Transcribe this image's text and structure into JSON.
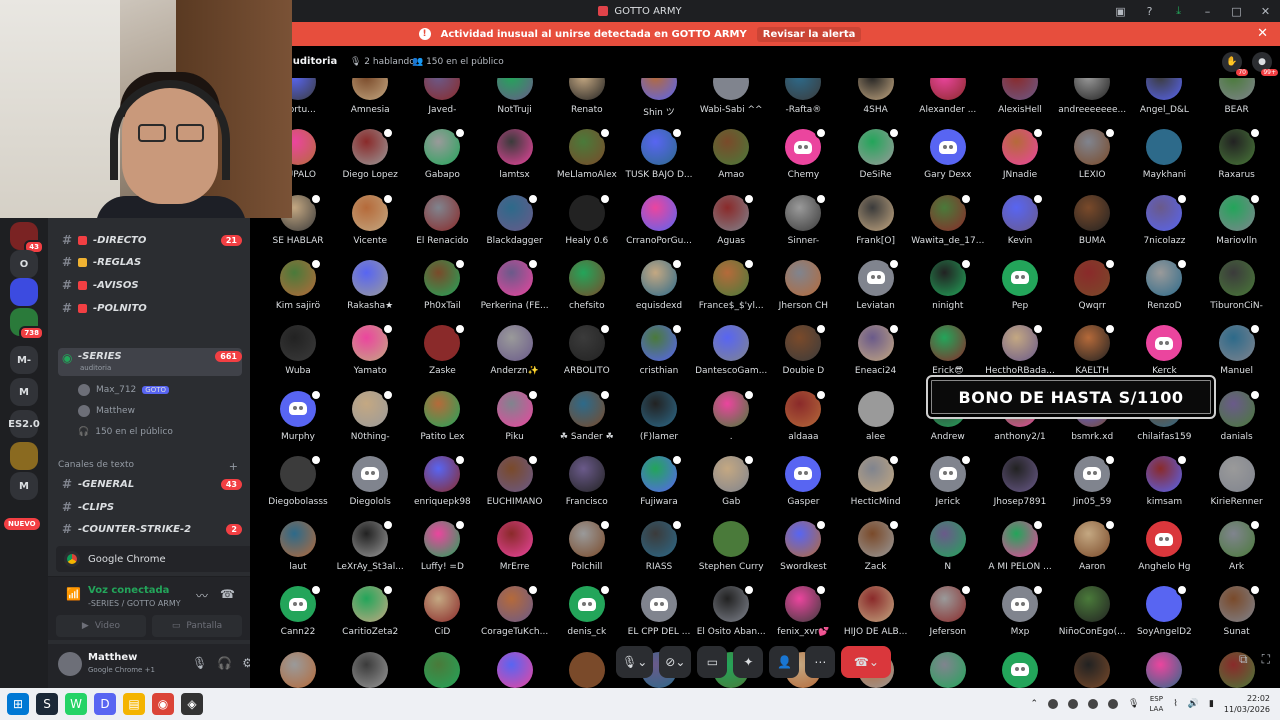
{
  "window": {
    "title": "GOTTO ARMY"
  },
  "alert": {
    "text": "Actividad inusual al unirse detectada en GOTTO ARMY",
    "link": "Revisar la alerta"
  },
  "rail": {
    "items": [
      {
        "label": "",
        "badge": "43"
      },
      {
        "label": "O",
        "badge": ""
      },
      {
        "label": "",
        "badge": ""
      },
      {
        "label": "",
        "badge": "738"
      },
      {
        "label": "M-",
        "badge": ""
      },
      {
        "label": "M",
        "badge": ""
      },
      {
        "label": "ES2.0",
        "badge": ""
      },
      {
        "label": "",
        "badge": ""
      },
      {
        "label": "M",
        "badge": ""
      }
    ],
    "new_label": "NUEVO"
  },
  "sidebar": {
    "channels_top": [
      {
        "name": "-DIRECTO",
        "count": "21",
        "color": "#f23f43"
      },
      {
        "name": "-REGLAS",
        "count": "",
        "color": "#f0b232"
      },
      {
        "name": "-AVISOS",
        "count": "",
        "color": "#f23f43"
      },
      {
        "name": "-POLNITO",
        "count": "",
        "color": "#f23f43"
      }
    ],
    "stage_channel": {
      "name": "-SERIES",
      "sub": "auditoria",
      "count": "661"
    },
    "stage_users": [
      {
        "name": "Max_712",
        "tag": "GOTO"
      },
      {
        "name": "Matthew",
        "tag": ""
      }
    ],
    "audience": "150 en el público",
    "category": "Canales de texto",
    "text_channels": [
      {
        "name": "-GENERAL",
        "count": "43"
      },
      {
        "name": "-CLIPS",
        "count": ""
      },
      {
        "name": "-COUNTER-STRIKE-2",
        "count": "2"
      }
    ],
    "chrome_app": "Google Chrome",
    "voice": {
      "status": "Voz conectada",
      "channel": "-SERIES / GOTTO ARMY",
      "video": "Video",
      "screen": "Pantalla"
    },
    "user": {
      "name": "Matthew",
      "sub": "Google Chrome +1"
    }
  },
  "stage": {
    "title": "auditoria",
    "speaking": "2 hablando",
    "audience": "150 en el público",
    "header_badges": [
      "70",
      "99+"
    ]
  },
  "promo": {
    "text": "BONO DE HASTA S/1100"
  },
  "grid_rows": [
    [
      "_Tortu...",
      "Amnesia",
      "Javed-",
      "NotTruji",
      "Renato",
      "Shin ツ",
      "Wabi-Sabi ^^",
      "-Rafta®",
      "4SHA",
      "Alexander ...",
      "AlexisHell",
      "andreeeeeee...",
      "Angel_D&L",
      "BEAR"
    ],
    [
      "UUPALO",
      "Diego Lopez",
      "Gabapo",
      "lamtsx",
      "MeLlamoAlex",
      "TUSK BAJO D...",
      "Amao",
      "Chemy",
      "DeSiRe",
      "Gary Dexx",
      "JNnadie",
      "LEXIO",
      "Maykhani",
      "Raxarus"
    ],
    [
      "SÉ HABLAR",
      "Vicente",
      "El Renacido",
      "Blackdagger",
      "Healy 0.6",
      "CrranoPorGu...",
      "Aguas",
      "Sinner-",
      "Frank[O]",
      "Wawita_de_17...",
      "Kevin",
      "BUMA",
      "7nicolazz",
      "Mariovlln"
    ],
    [
      "Kim sajirö",
      "Rakasha★",
      "Ph0xTail",
      "Perkerina (FE...",
      "chefsito",
      "equisdexd",
      "France$_$'yl...",
      "Jherson CH",
      "Leviatan",
      "ninight",
      "Pep",
      "Qwqrr",
      "RenzoD",
      "TiburonCiN-"
    ],
    [
      "Wuba",
      "Yamato",
      "Zaske",
      "Anderzn✨",
      "ARBOLITO",
      "cristhian",
      "DantescoGam...",
      "Doubie D",
      "Eneaci24",
      "Erick😎",
      "HecthoRBada...",
      "KAELTH",
      "Kerck",
      "Manuel"
    ],
    [
      "Murphy",
      "N0thing-",
      "Patito Lex",
      "Piku",
      "☘ Sander ☘",
      "(F)lamer",
      ".",
      "aldaaa",
      "alee",
      "Andrew",
      "anthony2/1",
      "bsmrk.xd",
      "chilaifas159",
      "danials"
    ],
    [
      "Diegobolasss",
      "Diegolols",
      "enriquepk98",
      "EUCHIMANO",
      "Francisco",
      "Fujiwara",
      "Gab",
      "Gasper",
      "HecticMind",
      "Jerick",
      "Jhosep7891",
      "Jin05_59",
      "kimsam",
      "KirieRenner"
    ],
    [
      "laut",
      "LeXrAy_St3al...",
      "Luffy! =D",
      "MrErre",
      "Polchill",
      "RIASS",
      "Stephen Curry",
      "Swordkest",
      "Zack",
      "Ñ",
      "A MI PELON ...",
      "Aaron",
      "Anghelo Hg",
      "Ark"
    ],
    [
      "Cann22",
      "CaritioZeta2",
      "CiD",
      "CorageTuKch...",
      "denis_ck",
      "EL CPP DEL ...",
      "El Osito Aban...",
      "fenix_xvr💕",
      "HIJO DE ALB...",
      "Jeferson",
      "Mxp",
      "NiñoConEgo(...",
      "SoyAngelD2",
      "Sunat"
    ],
    [
      "",
      "",
      "",
      "",
      "",
      "",
      "",
      "",
      "",
      "",
      "",
      "",
      "",
      ""
    ]
  ],
  "taskbar": {
    "lang_top": "ESP",
    "lang_bot": "LAA",
    "time": "22:02",
    "date": "11/03/2026"
  }
}
